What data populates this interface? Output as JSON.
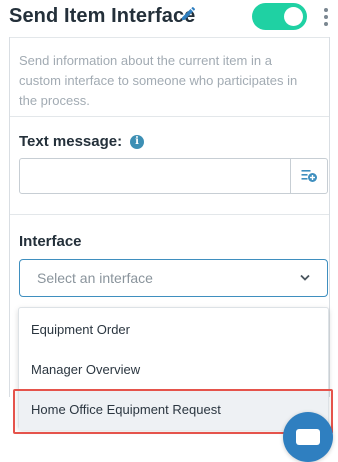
{
  "header": {
    "title": "Send Item Interface",
    "toggle_on": true,
    "accent_color": "#1fd1a3"
  },
  "panel": {
    "description": "Send information about the current item in a custom interface to someone who participates in the process.",
    "text_message": {
      "label": "Text message:",
      "value": "",
      "info_icon": "info-icon",
      "add_variable_icon": "add-variable-icon"
    },
    "interface": {
      "label": "Interface",
      "placeholder": "Select an interface",
      "options": [
        "Equipment Order",
        "Manager Overview",
        "Home Office Equipment Request"
      ],
      "highlighted_option_index": 2
    }
  },
  "icons": {
    "edit": "pencil-icon",
    "more": "kebab-menu-icon",
    "chat": "chat-icon"
  },
  "colors": {
    "highlight_border": "#e5534b",
    "info": "#3d8fb4",
    "select_border": "#3f8fbf"
  }
}
